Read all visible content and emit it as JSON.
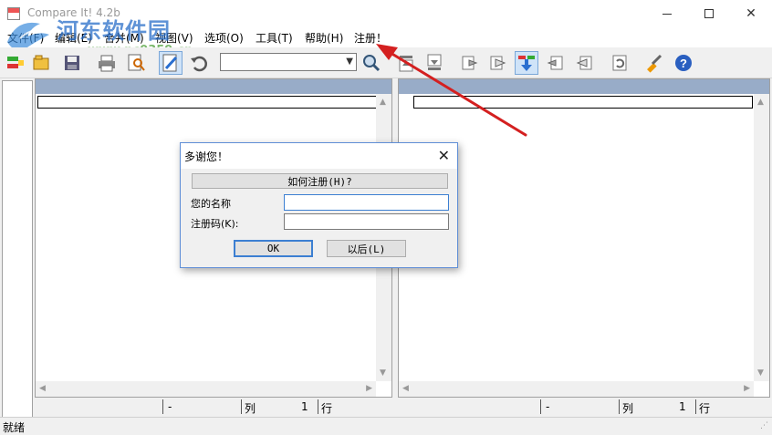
{
  "window": {
    "title": "Compare It! 4.2b"
  },
  "watermark": {
    "title": "河东软件园",
    "url": "www.pc0359.cn"
  },
  "menu": [
    {
      "label": "文件(F)"
    },
    {
      "label": "编辑(E)"
    },
    {
      "label": "合并(M)"
    },
    {
      "label": "视图(V)"
    },
    {
      "label": "选项(O)"
    },
    {
      "label": "工具(T)"
    },
    {
      "label": "帮助(H)"
    },
    {
      "label": "注册！"
    }
  ],
  "toolbar": {
    "search_value": ""
  },
  "left_pane": {
    "status": {
      "pos": "-",
      "col_label": "列",
      "col_value": "1",
      "row_label": "行"
    }
  },
  "right_pane": {
    "status": {
      "pos": "-",
      "col_label": "列",
      "col_value": "1",
      "row_label": "行"
    }
  },
  "statusbar": {
    "text": "就绪"
  },
  "dialog": {
    "title": "多谢您！",
    "how_button": "如何注册(H)?",
    "name_label": "您的名称",
    "code_label": "注册码(K):",
    "name_value": "",
    "code_value": "",
    "ok_button": "OK",
    "later_button": "以后(L)"
  },
  "colors": {
    "pane_header": "#98acc8",
    "annotation_arrow": "#d42020",
    "dialog_border": "#5f8ed6"
  }
}
